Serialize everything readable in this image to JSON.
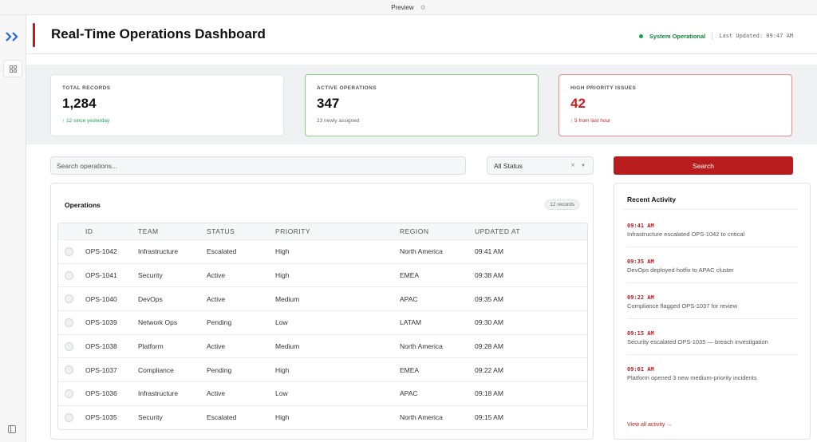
{
  "window": {
    "title": "Preview"
  },
  "header": {
    "title": "Real-Time Operations Dashboard",
    "status": "System Operational",
    "updated": "Last Updated: 09:47 AM"
  },
  "stats": [
    {
      "label": "TOTAL RECORDS",
      "value": "1,284",
      "sub": "↑ 12 since yesterday"
    },
    {
      "label": "ACTIVE OPERATIONS",
      "value": "347",
      "sub": "23 newly assigned"
    },
    {
      "label": "HIGH PRIORITY ISSUES",
      "value": "42",
      "sub": "↑ 5 from last hour"
    }
  ],
  "search": {
    "placeholder": "Search operations...",
    "button": "Search"
  },
  "filter": {
    "selected": "All Status"
  },
  "ops": {
    "title": "Operations",
    "badge": "12 records",
    "columns": [
      "ID",
      "TEAM",
      "STATUS",
      "PRIORITY",
      "REGION",
      "UPDATED AT"
    ],
    "rows": [
      [
        "OPS-1042",
        "Infrastructure",
        "Escalated",
        "High",
        "North America",
        "09:41 AM"
      ],
      [
        "OPS-1041",
        "Security",
        "Active",
        "High",
        "EMEA",
        "09:38 AM"
      ],
      [
        "OPS-1040",
        "DevOps",
        "Active",
        "Medium",
        "APAC",
        "09:35 AM"
      ],
      [
        "OPS-1039",
        "Network Ops",
        "Pending",
        "Low",
        "LATAM",
        "09:30 AM"
      ],
      [
        "OPS-1038",
        "Platform",
        "Active",
        "Medium",
        "North America",
        "09:28 AM"
      ],
      [
        "OPS-1037",
        "Compliance",
        "Pending",
        "High",
        "EMEA",
        "09:22 AM"
      ],
      [
        "OPS-1036",
        "Infrastructure",
        "Active",
        "Low",
        "APAC",
        "09:18 AM"
      ],
      [
        "OPS-1035",
        "Security",
        "Escalated",
        "High",
        "North America",
        "09:15 AM"
      ]
    ]
  },
  "activity": {
    "title": "Recent Activity",
    "items": [
      {
        "time": "09:41 AM",
        "text": "Infrastructure escalated OPS-1042 to critical"
      },
      {
        "time": "09:35 AM",
        "text": "DevOps deployed hotfix to APAC cluster"
      },
      {
        "time": "09:22 AM",
        "text": "Compliance flagged OPS-1037 for review"
      },
      {
        "time": "09:15 AM",
        "text": "Security escalated OPS-1035 — breach investigation"
      },
      {
        "time": "09:01 AM",
        "text": "Platform opened 3 new medium-priority incidents"
      }
    ],
    "view_all": "View all activity →"
  }
}
